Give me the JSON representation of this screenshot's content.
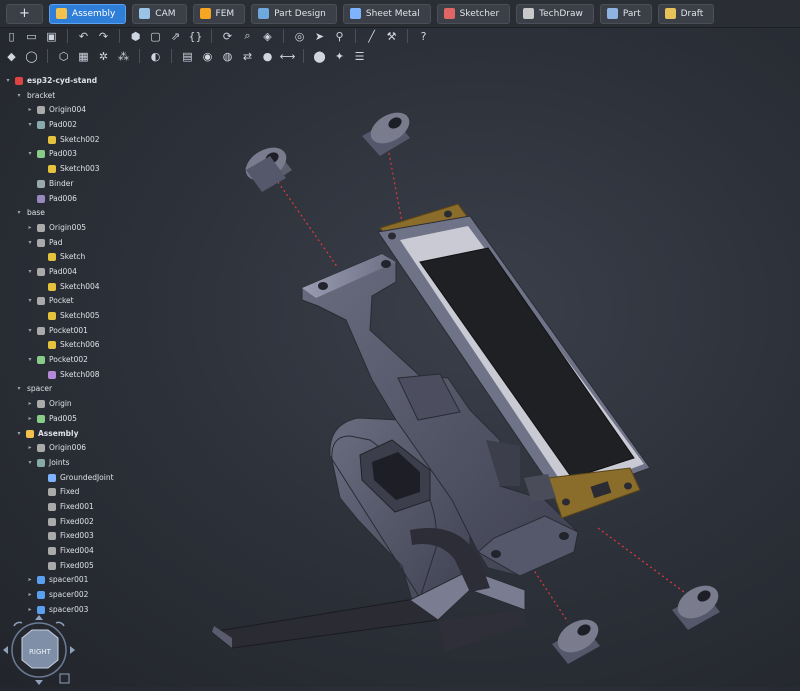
{
  "workbench_tabs": {
    "add": "+",
    "items": [
      {
        "label": "Assembly",
        "icon": "assembly-icon",
        "active": true,
        "color": "#f2c14e"
      },
      {
        "label": "CAM",
        "icon": "cam-icon",
        "active": false,
        "color": "#9bc3e6"
      },
      {
        "label": "FEM",
        "icon": "fem-icon",
        "active": false,
        "color": "#f5a623"
      },
      {
        "label": "Part Design",
        "icon": "part-design-icon",
        "active": false,
        "color": "#6fa8dc"
      },
      {
        "label": "Sheet Metal",
        "icon": "sheet-metal-icon",
        "active": false,
        "color": "#7fb3ff"
      },
      {
        "label": "Sketcher",
        "icon": "sketcher-icon",
        "active": false,
        "color": "#e06666"
      },
      {
        "label": "TechDraw",
        "icon": "techdraw-icon",
        "active": false,
        "color": "#c9c9c9"
      },
      {
        "label": "Part",
        "icon": "part-icon",
        "active": false,
        "color": "#8fb4e3"
      },
      {
        "label": "Draft",
        "icon": "draft-icon",
        "active": false,
        "color": "#e8c35a"
      }
    ]
  },
  "toolbar_row1": [
    "new-file-icon",
    "open-file-icon",
    "save-icon",
    "sep",
    "undo-icon",
    "redo-icon",
    "sep",
    "part-icon",
    "folder-icon",
    "export-icon",
    "macro-braces-icon",
    "sep",
    "refresh-icon",
    "zoom-icon",
    "view-cube-icon",
    "sep",
    "std-views-icon",
    "select-icon",
    "zoom-selection-icon",
    "sep",
    "measure-icon",
    "workbench-tool-icon",
    "sep",
    "whats-this-icon"
  ],
  "toolbar_row2": [
    "assembly-create-icon",
    "ring-icon",
    "sep",
    "insert-part-icon",
    "box-icon",
    "gear-shape-icon",
    "nodes-icon",
    "sep",
    "joint-icon",
    "sep",
    "joint-fixed-icon",
    "joint-revolute-icon",
    "joint-cylindrical-icon",
    "joint-slider-icon",
    "joint-ball-icon",
    "joint-distance-icon",
    "sep",
    "solve-icon",
    "explode-icon",
    "bom-icon"
  ],
  "tree": [
    {
      "label": "esp32-cyd-stand",
      "level": 0,
      "arrow": "down",
      "icon": "document-icon",
      "iconColor": "#d44",
      "bold": true
    },
    {
      "label": "bracket",
      "level": 1,
      "arrow": "down",
      "icon": "none",
      "bold": false
    },
    {
      "label": "Origin004",
      "level": 2,
      "arrow": "right",
      "icon": "origin-icon",
      "iconColor": "#aaa"
    },
    {
      "label": "Pad002",
      "level": 2,
      "arrow": "down",
      "icon": "pad-icon",
      "iconColor": "#8aa"
    },
    {
      "label": "Sketch002",
      "level": 3,
      "arrow": "",
      "icon": "sketch-icon",
      "iconColor": "#e4c23b"
    },
    {
      "label": "Pad003",
      "level": 2,
      "arrow": "down",
      "icon": "pad-icon",
      "iconColor": "#8c8"
    },
    {
      "label": "Sketch003",
      "level": 3,
      "arrow": "",
      "icon": "sketch-icon",
      "iconColor": "#e4c23b"
    },
    {
      "label": "Binder",
      "level": 2,
      "arrow": "",
      "icon": "binder-icon",
      "iconColor": "#9aa"
    },
    {
      "label": "Pad006",
      "level": 2,
      "arrow": "",
      "icon": "pad-icon",
      "iconColor": "#98b"
    },
    {
      "label": "base",
      "level": 1,
      "arrow": "down",
      "icon": "none"
    },
    {
      "label": "Origin005",
      "level": 2,
      "arrow": "right",
      "icon": "origin-icon",
      "iconColor": "#aaa"
    },
    {
      "label": "Pad",
      "level": 2,
      "arrow": "down",
      "icon": "pad-icon",
      "iconColor": "#aaa"
    },
    {
      "label": "Sketch",
      "level": 3,
      "arrow": "",
      "icon": "sketch-icon",
      "iconColor": "#e4c23b"
    },
    {
      "label": "Pad004",
      "level": 2,
      "arrow": "down",
      "icon": "pad-icon",
      "iconColor": "#aaa"
    },
    {
      "label": "Sketch004",
      "level": 3,
      "arrow": "",
      "icon": "sketch-icon",
      "iconColor": "#e4c23b"
    },
    {
      "label": "Pocket",
      "level": 2,
      "arrow": "down",
      "icon": "pocket-icon",
      "iconColor": "#aaa"
    },
    {
      "label": "Sketch005",
      "level": 3,
      "arrow": "",
      "icon": "sketch-icon",
      "iconColor": "#e4c23b"
    },
    {
      "label": "Pocket001",
      "level": 2,
      "arrow": "down",
      "icon": "pocket-icon",
      "iconColor": "#aaa"
    },
    {
      "label": "Sketch006",
      "level": 3,
      "arrow": "",
      "icon": "sketch-icon",
      "iconColor": "#e4c23b"
    },
    {
      "label": "Pocket002",
      "level": 2,
      "arrow": "down",
      "icon": "pocket-icon",
      "iconColor": "#8c8"
    },
    {
      "label": "Sketch008",
      "level": 3,
      "arrow": "",
      "icon": "sketch-icon",
      "iconColor": "#b48ad8"
    },
    {
      "label": "spacer",
      "level": 1,
      "arrow": "down",
      "icon": "none"
    },
    {
      "label": "Origin",
      "level": 2,
      "arrow": "right",
      "icon": "origin-icon",
      "iconColor": "#aaa"
    },
    {
      "label": "Pad005",
      "level": 2,
      "arrow": "right",
      "icon": "pad-icon",
      "iconColor": "#8c8"
    },
    {
      "label": "Assembly",
      "level": 1,
      "arrow": "down",
      "icon": "assembly-icon",
      "iconColor": "#f2c14e",
      "bold": true
    },
    {
      "label": "Origin006",
      "level": 2,
      "arrow": "right",
      "icon": "origin-icon",
      "iconColor": "#aaa"
    },
    {
      "label": "Joints",
      "level": 2,
      "arrow": "down",
      "icon": "joints-icon",
      "iconColor": "#8aa"
    },
    {
      "label": "GroundedJoint",
      "level": 3,
      "arrow": "",
      "icon": "grounded-joint-icon",
      "iconColor": "#7fb3ff"
    },
    {
      "label": "Fixed",
      "level": 3,
      "arrow": "",
      "icon": "fixed-joint-icon",
      "iconColor": "#aaa"
    },
    {
      "label": "Fixed001",
      "level": 3,
      "arrow": "",
      "icon": "fixed-joint-icon",
      "iconColor": "#aaa"
    },
    {
      "label": "Fixed002",
      "level": 3,
      "arrow": "",
      "icon": "fixed-joint-icon",
      "iconColor": "#aaa"
    },
    {
      "label": "Fixed003",
      "level": 3,
      "arrow": "",
      "icon": "fixed-joint-icon",
      "iconColor": "#aaa"
    },
    {
      "label": "Fixed004",
      "level": 3,
      "arrow": "",
      "icon": "fixed-joint-icon",
      "iconColor": "#aaa"
    },
    {
      "label": "Fixed005",
      "level": 3,
      "arrow": "",
      "icon": "fixed-joint-icon",
      "iconColor": "#aaa"
    },
    {
      "label": "spacer001",
      "level": 2,
      "arrow": "right",
      "icon": "link-icon",
      "iconColor": "#5aa0f0"
    },
    {
      "label": "spacer002",
      "level": 2,
      "arrow": "right",
      "icon": "link-icon",
      "iconColor": "#5aa0f0"
    },
    {
      "label": "spacer003",
      "level": 2,
      "arrow": "right",
      "icon": "link-icon",
      "iconColor": "#5aa0f0"
    }
  ],
  "navcube": {
    "face": "RIGHT"
  },
  "colors": {
    "accent": "#2f7fd8",
    "pcb": "#8a6d2a",
    "screen": "#1f2024",
    "plastic": "#4a4c5a",
    "joint_line": "#e03a3a"
  }
}
